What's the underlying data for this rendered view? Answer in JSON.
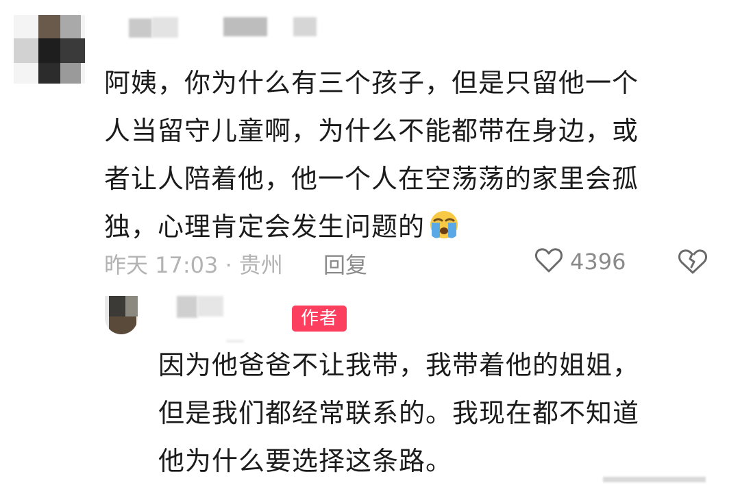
{
  "comment": {
    "lines": [
      "阿姨，你为什么有三个孩子，但是只留他一个",
      "人当留守儿童啊，为什么不能都带在身边，或",
      "者让人陪着他，他一个人在空荡荡的家里会孤",
      "独，心理肯定会发生问题的"
    ],
    "emoji": "loudly-crying-face",
    "time_location": "昨天 17:03 · 贵州",
    "reply_label": "回复",
    "like_count": "4396"
  },
  "reply": {
    "badge": "作者",
    "lines": [
      "因为他爸爸不让我带，我带着他的姐姐，",
      "但是我们都经常联系的。我现在都不知道",
      "他为什么要选择这条路。"
    ]
  },
  "colors": {
    "badge_bg": "#fc3f5e",
    "meta_gray": "#b3b3b3",
    "action_gray": "#8a8a8a"
  }
}
